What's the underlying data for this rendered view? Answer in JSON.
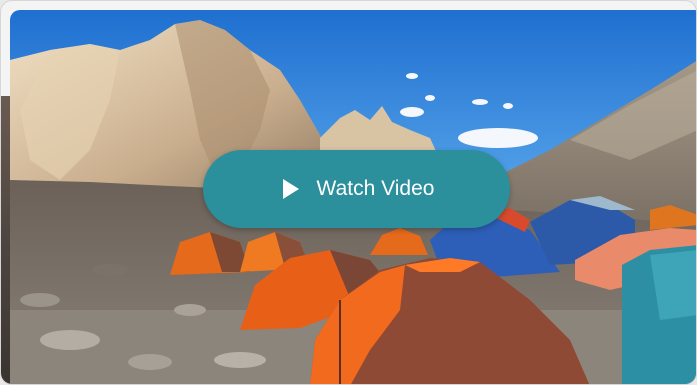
{
  "video_card": {
    "watch_label": "Watch Video",
    "play_icon": "play-icon",
    "button_color": "#2b8f9c"
  }
}
